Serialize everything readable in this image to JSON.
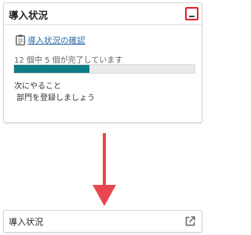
{
  "expanded_widget": {
    "title": "導入状況",
    "link_label": "導入状況の確認",
    "progress_text": "12 個中 5 個が完了しています",
    "progress": {
      "completed": 5,
      "total": 12
    },
    "next_heading": "次にやること",
    "next_item": "部門を登録しましょう",
    "minimize_icon": "minimize-icon",
    "clipboard_icon": "clipboard-icon"
  },
  "arrow": {
    "direction": "down"
  },
  "collapsed_widget": {
    "title": "導入状況",
    "open_icon": "open-external-icon"
  },
  "colors": {
    "progress_fill": "#0e7c86",
    "progress_track": "#e9e9e9",
    "highlight": "#e0202c",
    "arrow": "#e8474f",
    "link": "#2f6aa8"
  }
}
